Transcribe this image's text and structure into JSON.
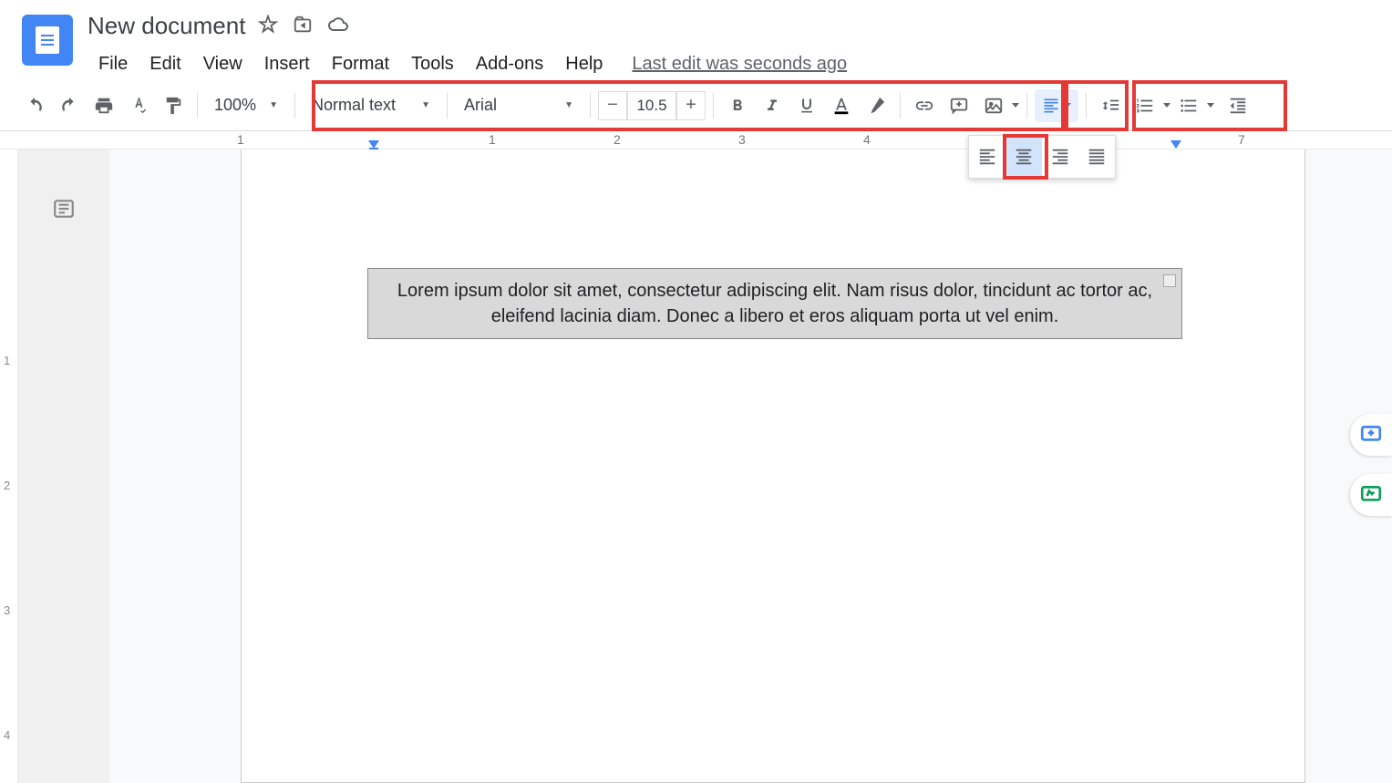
{
  "header": {
    "title": "New document",
    "last_edit": "Last edit was seconds ago",
    "menus": [
      "File",
      "Edit",
      "View",
      "Insert",
      "Format",
      "Tools",
      "Add-ons",
      "Help"
    ]
  },
  "toolbar": {
    "zoom": "100%",
    "style": "Normal text",
    "font": "Arial",
    "font_size": "10.5"
  },
  "ruler": {
    "numbers": [
      "1",
      "1",
      "2",
      "3",
      "4",
      "7"
    ]
  },
  "document": {
    "text": "Lorem ipsum dolor sit amet, consectetur adipiscing elit. Nam risus dolor, tincidunt ac tortor ac, eleifend lacinia diam. Donec a libero et eros aliquam porta ut vel enim."
  },
  "vruler": [
    "1",
    "2",
    "3",
    "4"
  ]
}
